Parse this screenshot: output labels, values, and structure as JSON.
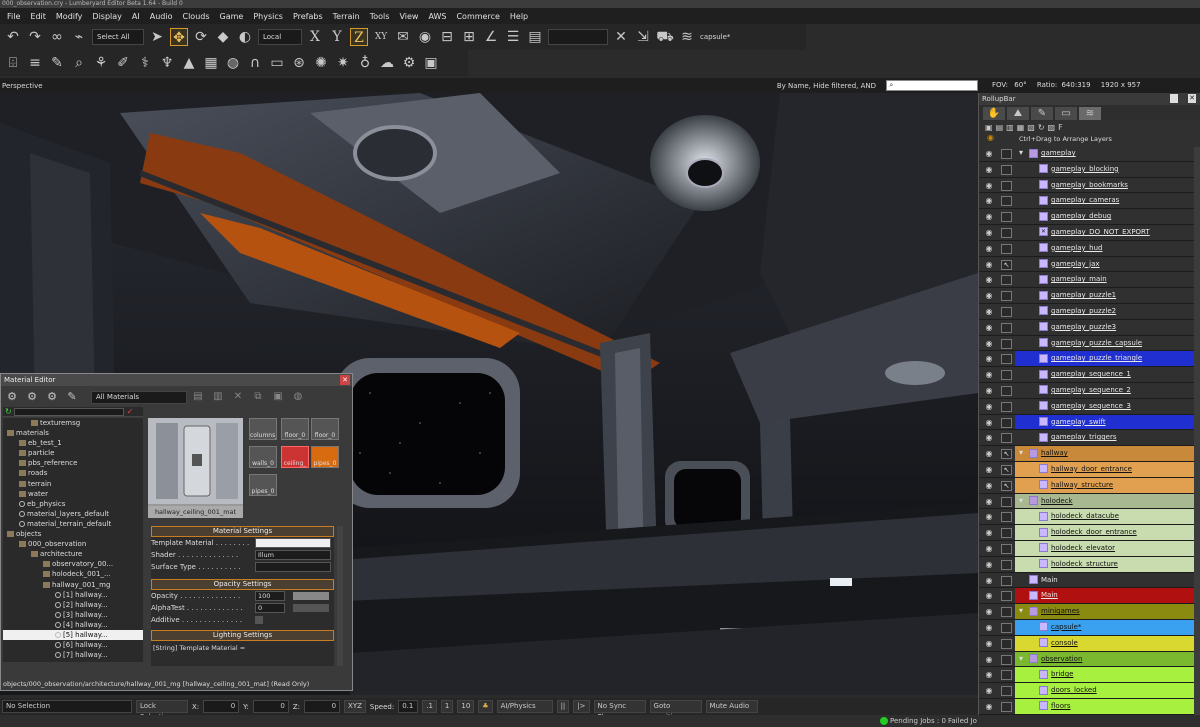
{
  "window_title": "000_observation.cry - Lumberyard Editor Beta 1.64 - Build 0",
  "menu": [
    "File",
    "Edit",
    "Modify",
    "Display",
    "AI",
    "Audio",
    "Clouds",
    "Game",
    "Physics",
    "Prefabs",
    "Terrain",
    "Tools",
    "View",
    "AWS",
    "Commerce",
    "Help"
  ],
  "toolbar": {
    "select_all": "Select All",
    "coord_system": "Local",
    "axis_x": "X",
    "axis_y": "Y",
    "axis_z": "Z",
    "axis_xy": "XY",
    "object_name": "capsule*"
  },
  "viewport": {
    "name": "Perspective",
    "filter_text": "By Name, Hide filtered, AND",
    "search_placeholder": "",
    "fov_label": "FOV:",
    "fov_value": "60°",
    "ratio_label": "Ratio:",
    "ratio_value": "640:319",
    "resolution": "1920 x 957"
  },
  "material_editor": {
    "title": "Material Editor",
    "library_select": "All Materials",
    "tree": [
      {
        "label": "texturemsg",
        "indent": 2,
        "type": "folder"
      },
      {
        "label": "materials",
        "indent": 0,
        "type": "folder"
      },
      {
        "label": "eb_test_1",
        "indent": 1,
        "type": "folder"
      },
      {
        "label": "particle",
        "indent": 1,
        "type": "folder"
      },
      {
        "label": "pbs_reference",
        "indent": 1,
        "type": "folder"
      },
      {
        "label": "roads",
        "indent": 1,
        "type": "folder"
      },
      {
        "label": "terrain",
        "indent": 1,
        "type": "folder"
      },
      {
        "label": "water",
        "indent": 1,
        "type": "folder"
      },
      {
        "label": "eb_physics",
        "indent": 1,
        "type": "sphere"
      },
      {
        "label": "material_layers_default",
        "indent": 1,
        "type": "sphere"
      },
      {
        "label": "material_terrain_default",
        "indent": 1,
        "type": "sphere"
      },
      {
        "label": "objects",
        "indent": 0,
        "type": "folder"
      },
      {
        "label": "000_observation",
        "indent": 1,
        "type": "folder"
      },
      {
        "label": "architecture",
        "indent": 2,
        "type": "folder"
      },
      {
        "label": "observatory_00...",
        "indent": 3,
        "type": "folder"
      },
      {
        "label": "holodeck_001_...",
        "indent": 3,
        "type": "folder"
      },
      {
        "label": "hallway_001_mg",
        "indent": 3,
        "type": "folder"
      },
      {
        "label": "[1] hallway...",
        "indent": 4,
        "type": "sphere"
      },
      {
        "label": "[2] hallway...",
        "indent": 4,
        "type": "sphere"
      },
      {
        "label": "[3] hallway...",
        "indent": 4,
        "type": "sphere"
      },
      {
        "label": "[4] hallway...",
        "indent": 4,
        "type": "sphere"
      },
      {
        "label": "[5] hallway...",
        "indent": 4,
        "type": "sphere",
        "selected": true
      },
      {
        "label": "[6] hallway...",
        "indent": 4,
        "type": "sphere"
      },
      {
        "label": "[7] hallway...",
        "indent": 4,
        "type": "sphere"
      }
    ],
    "preview_name": "hallway_ceiling_001_mat",
    "thumbnails": [
      "columns_",
      "floor_0",
      "floor_0",
      "walls_0",
      "ceiling_",
      "pipes_0",
      "pipes_0"
    ],
    "sections": {
      "material": "Material Settings",
      "opacity": "Opacity Settings",
      "lighting": "Lighting Settings"
    },
    "props": {
      "template_label": "Template Material . . . . . . . .",
      "template_value": "",
      "shader_label": "Shader . . . . . . . . . . . . . .",
      "shader_value": "Illum",
      "surface_label": "Surface Type . . . . . . . . . .",
      "surface_value": "",
      "opacity_label": "Opacity . . . . . . . . . . . . . .",
      "opacity_value": "100",
      "alphatest_label": "AlphaTest . . . . . . . . . . . . .",
      "alphatest_value": "0",
      "additive_label": "Additive . . . . . . . . . . . . . ."
    },
    "tooltip": "[String] Template Material =",
    "path": "objects/000_observation/architecture/hallway_001_mg [hallway_ceiling_001_mat] (Read Only)"
  },
  "bottom_bar": {
    "selection": "No Selection",
    "lock_selection": "Lock Selection",
    "x_label": "X:",
    "x_value": "0",
    "y_label": "Y:",
    "y_value": "0",
    "z_label": "Z:",
    "z_value": "0",
    "xyz": "XYZ",
    "speed_label": "Speed:",
    "speed_value": "0.1",
    "s1": ".1",
    "s2": "1",
    "s3": "10",
    "ai_physics": "AI/Physics",
    "pause": "||",
    "step": "|>",
    "no_sync": "No Sync Player",
    "goto": "Goto position",
    "mute": "Mute Audio",
    "pending": "Pending Jobs : 0",
    "failed": "Failed Jo"
  },
  "rollup": {
    "title": "RollupBar",
    "hint": "Ctrl+Drag to Arrange Layers",
    "layers": [
      {
        "name": "gameplay",
        "level": 0,
        "bg": "",
        "folder": true,
        "cb": ""
      },
      {
        "name": "gameplay_blocking",
        "level": 1,
        "bg": "",
        "cb": ""
      },
      {
        "name": "gameplay_bookmarks",
        "level": 1,
        "bg": "",
        "cb": ""
      },
      {
        "name": "gameplay_cameras",
        "level": 1,
        "bg": "",
        "cb": ""
      },
      {
        "name": "gameplay_debug",
        "level": 1,
        "bg": "",
        "cb": ""
      },
      {
        "name": "gameplay_DO_NOT_EXPORT",
        "level": 1,
        "bg": "",
        "cb": "",
        "x": true
      },
      {
        "name": "gameplay_hud",
        "level": 1,
        "bg": "",
        "cb": ""
      },
      {
        "name": "gameplay_jax",
        "level": 1,
        "bg": "",
        "cb": "↖"
      },
      {
        "name": "gameplay_main",
        "level": 1,
        "bg": "",
        "cb": ""
      },
      {
        "name": "gameplay_puzzle1",
        "level": 1,
        "bg": "",
        "cb": ""
      },
      {
        "name": "gameplay_puzzle2",
        "level": 1,
        "bg": "",
        "cb": ""
      },
      {
        "name": "gameplay_puzzle3",
        "level": 1,
        "bg": "",
        "cb": ""
      },
      {
        "name": "gameplay_puzzle_capsule",
        "level": 1,
        "bg": "",
        "cb": ""
      },
      {
        "name": "gameplay_puzzle_triangle",
        "level": 1,
        "bg": "#1f2fd0",
        "cb": ""
      },
      {
        "name": "gameplay_sequence_1",
        "level": 1,
        "bg": "",
        "cb": ""
      },
      {
        "name": "gameplay_sequence_2",
        "level": 1,
        "bg": "",
        "cb": ""
      },
      {
        "name": "gameplay_sequence_3",
        "level": 1,
        "bg": "",
        "cb": ""
      },
      {
        "name": "gameplay_swift",
        "level": 1,
        "bg": "#1f2fd0",
        "cb": ""
      },
      {
        "name": "gameplay_triggers",
        "level": 1,
        "bg": "",
        "cb": ""
      },
      {
        "name": "hallway",
        "level": 0,
        "bg": "#c88a3a",
        "folder": true,
        "cb": "↖"
      },
      {
        "name": "hallway_door_entrance",
        "level": 1,
        "bg": "#e0a050",
        "cb": "↖"
      },
      {
        "name": "hallway_structure",
        "level": 1,
        "bg": "#e0a050",
        "cb": "↖"
      },
      {
        "name": "holodeck",
        "level": 0,
        "bg": "#a8b890",
        "folder": true,
        "cb": ""
      },
      {
        "name": "holodeck_datacube",
        "level": 1,
        "bg": "#c8dcb0",
        "cb": ""
      },
      {
        "name": "holodeck_door_entrance",
        "level": 1,
        "bg": "#c8dcb0",
        "cb": ""
      },
      {
        "name": "holodeck_elevator",
        "level": 1,
        "bg": "#c8dcb0",
        "cb": ""
      },
      {
        "name": "holodeck_structure",
        "level": 1,
        "bg": "#c8dcb0",
        "cb": ""
      },
      {
        "name": "Main",
        "level": 0,
        "bg": "",
        "folder": false,
        "cb": "",
        "plain": true
      },
      {
        "name": "Main",
        "level": 0,
        "bg": "#b01010",
        "folder": false,
        "cb": ""
      },
      {
        "name": "minigames",
        "level": 0,
        "bg": "#8a8a10",
        "folder": true,
        "cb": ""
      },
      {
        "name": "capsule*",
        "level": 1,
        "bg": "#3aa0f0",
        "cb": ""
      },
      {
        "name": "console",
        "level": 1,
        "bg": "#d8d830",
        "cb": ""
      },
      {
        "name": "observation",
        "level": 0,
        "bg": "#7ab830",
        "folder": true,
        "cb": ""
      },
      {
        "name": "bridge",
        "level": 1,
        "bg": "#a8f040",
        "cb": ""
      },
      {
        "name": "doors_locked",
        "level": 1,
        "bg": "#a8f040",
        "cb": ""
      },
      {
        "name": "floors",
        "level": 1,
        "bg": "#a8f040",
        "cb": ""
      }
    ]
  }
}
